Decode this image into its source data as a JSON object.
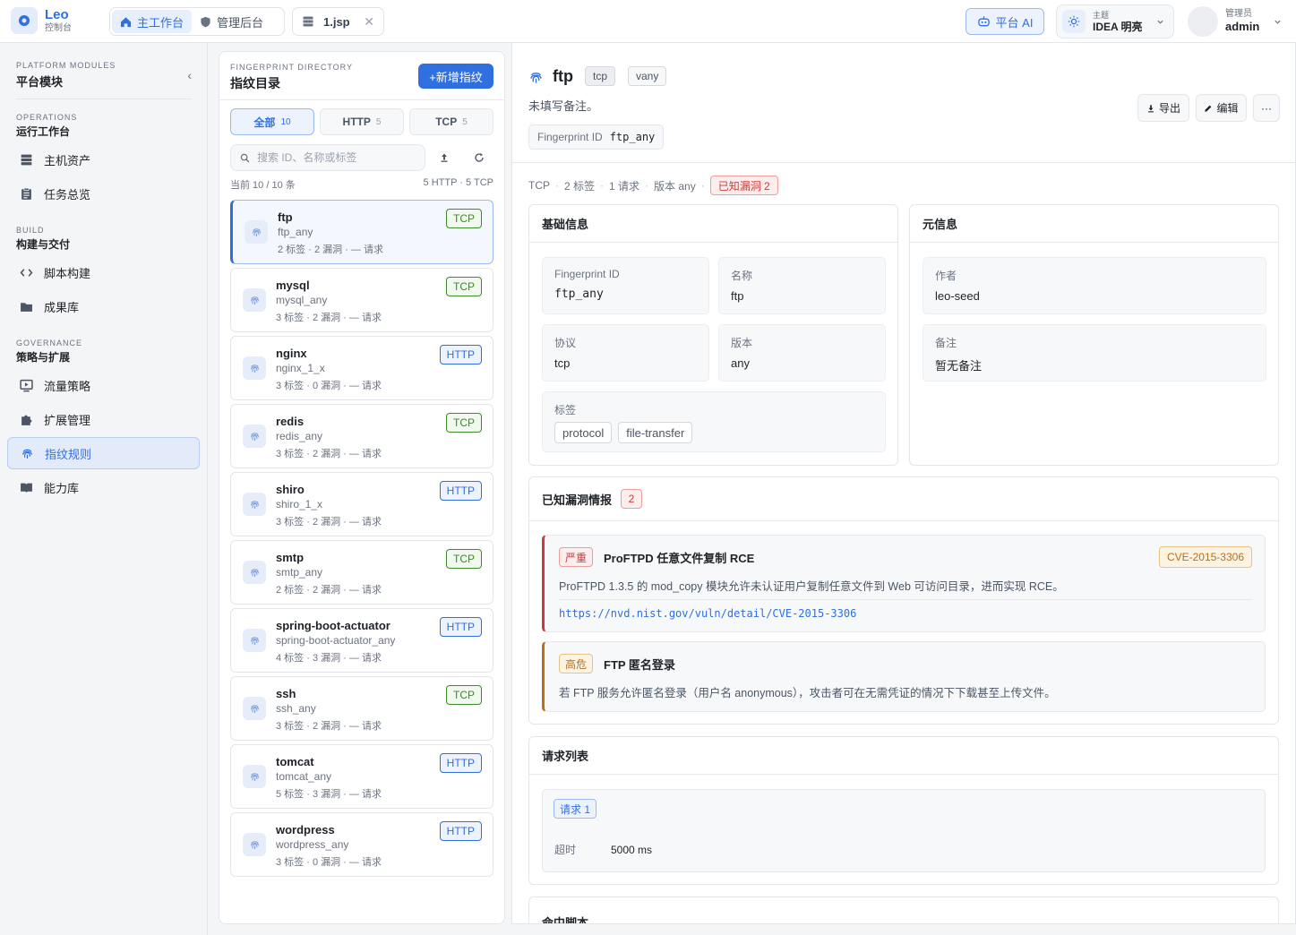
{
  "topbar": {
    "brand_name": "Leo",
    "brand_sub": "控制台",
    "nav": [
      {
        "label": "主工作台"
      },
      {
        "label": "管理后台"
      }
    ],
    "file_tab": "1.jsp",
    "ai_button": "平台 AI",
    "theme_label": "主题",
    "theme_value": "IDEA 明亮",
    "user_role": "管理员",
    "user_name": "admin"
  },
  "sidebar": {
    "eyebrow": "PLATFORM MODULES",
    "title": "平台模块",
    "collapse_icon": "chevron-left",
    "sections": [
      {
        "eyebrow": "OPERATIONS",
        "title": "运行工作台",
        "items": [
          {
            "label": "主机资产",
            "icon": "server-icon"
          },
          {
            "label": "任务总览",
            "icon": "clipboard-icon"
          }
        ]
      },
      {
        "eyebrow": "BUILD",
        "title": "构建与交付",
        "items": [
          {
            "label": "脚本构建",
            "icon": "code-icon"
          },
          {
            "label": "成果库",
            "icon": "folder-icon"
          }
        ]
      },
      {
        "eyebrow": "GOVERNANCE",
        "title": "策略与扩展",
        "items": [
          {
            "label": "流量策略",
            "icon": "monitor-icon"
          },
          {
            "label": "扩展管理",
            "icon": "puzzle-icon"
          },
          {
            "label": "指纹规则",
            "icon": "fingerprint-icon",
            "active": true
          },
          {
            "label": "能力库",
            "icon": "book-icon"
          }
        ]
      }
    ]
  },
  "directory": {
    "eyebrow": "FINGERPRINT DIRECTORY",
    "title": "指纹目录",
    "add_button": "+新增指纹",
    "tabs": [
      {
        "label": "全部",
        "count": "10"
      },
      {
        "label": "HTTP",
        "count": "5"
      },
      {
        "label": "TCP",
        "count": "5"
      }
    ],
    "search_placeholder": "搜索 ID、名称或标签",
    "current": "当前 10 / 10 条",
    "summary": "5 HTTP · 5 TCP",
    "items": [
      {
        "name": "ftp",
        "id": "ftp_any",
        "stats": "2 标签 · 2 漏洞 · — 请求",
        "proto": "TCP"
      },
      {
        "name": "mysql",
        "id": "mysql_any",
        "stats": "3 标签 · 2 漏洞 · — 请求",
        "proto": "TCP"
      },
      {
        "name": "nginx",
        "id": "nginx_1_x",
        "stats": "3 标签 · 0 漏洞 · — 请求",
        "proto": "HTTP"
      },
      {
        "name": "redis",
        "id": "redis_any",
        "stats": "3 标签 · 2 漏洞 · — 请求",
        "proto": "TCP"
      },
      {
        "name": "shiro",
        "id": "shiro_1_x",
        "stats": "3 标签 · 2 漏洞 · — 请求",
        "proto": "HTTP"
      },
      {
        "name": "smtp",
        "id": "smtp_any",
        "stats": "2 标签 · 2 漏洞 · — 请求",
        "proto": "TCP"
      },
      {
        "name": "spring-boot-actuator",
        "id": "spring-boot-actuator_any",
        "stats": "4 标签 · 3 漏洞 · — 请求",
        "proto": "HTTP"
      },
      {
        "name": "ssh",
        "id": "ssh_any",
        "stats": "3 标签 · 2 漏洞 · — 请求",
        "proto": "TCP"
      },
      {
        "name": "tomcat",
        "id": "tomcat_any",
        "stats": "5 标签 · 3 漏洞 · — 请求",
        "proto": "HTTP"
      },
      {
        "name": "wordpress",
        "id": "wordpress_any",
        "stats": "3 标签 · 0 漏洞 · — 请求",
        "proto": "HTTP"
      }
    ]
  },
  "detail": {
    "name": "ftp",
    "chip_proto": "tcp",
    "chip_version": "vany",
    "remark": "未填写备注。",
    "fp_label": "Fingerprint ID",
    "fp_value": "ftp_any",
    "actions": {
      "export": "导出",
      "edit": "编辑",
      "more": "···"
    },
    "summary": [
      "TCP",
      "2 标签",
      "1 请求",
      "版本 any"
    ],
    "vuln_chip": "已知漏洞 2",
    "basic": {
      "title": "基础信息",
      "fields": [
        {
          "label": "Fingerprint ID",
          "value": "ftp_any"
        },
        {
          "label": "名称",
          "value": "ftp"
        },
        {
          "label": "协议",
          "value": "tcp"
        },
        {
          "label": "版本",
          "value": "any"
        }
      ],
      "tags_label": "标签",
      "tags": [
        "protocol",
        "file-transfer"
      ]
    },
    "meta": {
      "title": "元信息",
      "fields": [
        {
          "label": "作者",
          "value": "leo-seed"
        },
        {
          "label": "备注",
          "value": "暂无备注"
        }
      ]
    },
    "vulns": {
      "title": "已知漏洞情报",
      "count": "2",
      "items": [
        {
          "severity": "严重",
          "title": "ProFTPD 任意文件复制 RCE",
          "cve": "CVE-2015-3306",
          "desc": "ProFTPD 1.3.5 的 mod_copy 模块允许未认证用户复制任意文件到 Web 可访问目录，进而实现 RCE。",
          "link": "https://nvd.nist.gov/vuln/detail/CVE-2015-3306"
        },
        {
          "severity": "高危",
          "title": "FTP 匿名登录",
          "desc": "若 FTP 服务允许匿名登录（用户名 anonymous），攻击者可在无需凭证的情况下下载甚至上传文件。"
        }
      ]
    },
    "requests": {
      "title": "请求列表",
      "tag": "请求 1",
      "timeout_label": "超时",
      "timeout_value": "5000 ms"
    },
    "hit_script": {
      "title": "命中脚本"
    }
  },
  "colors": {
    "accent": "#2f6fe0",
    "critical": "#c93b3b",
    "high": "#b7701c",
    "tcp": "#3c8a2a"
  }
}
